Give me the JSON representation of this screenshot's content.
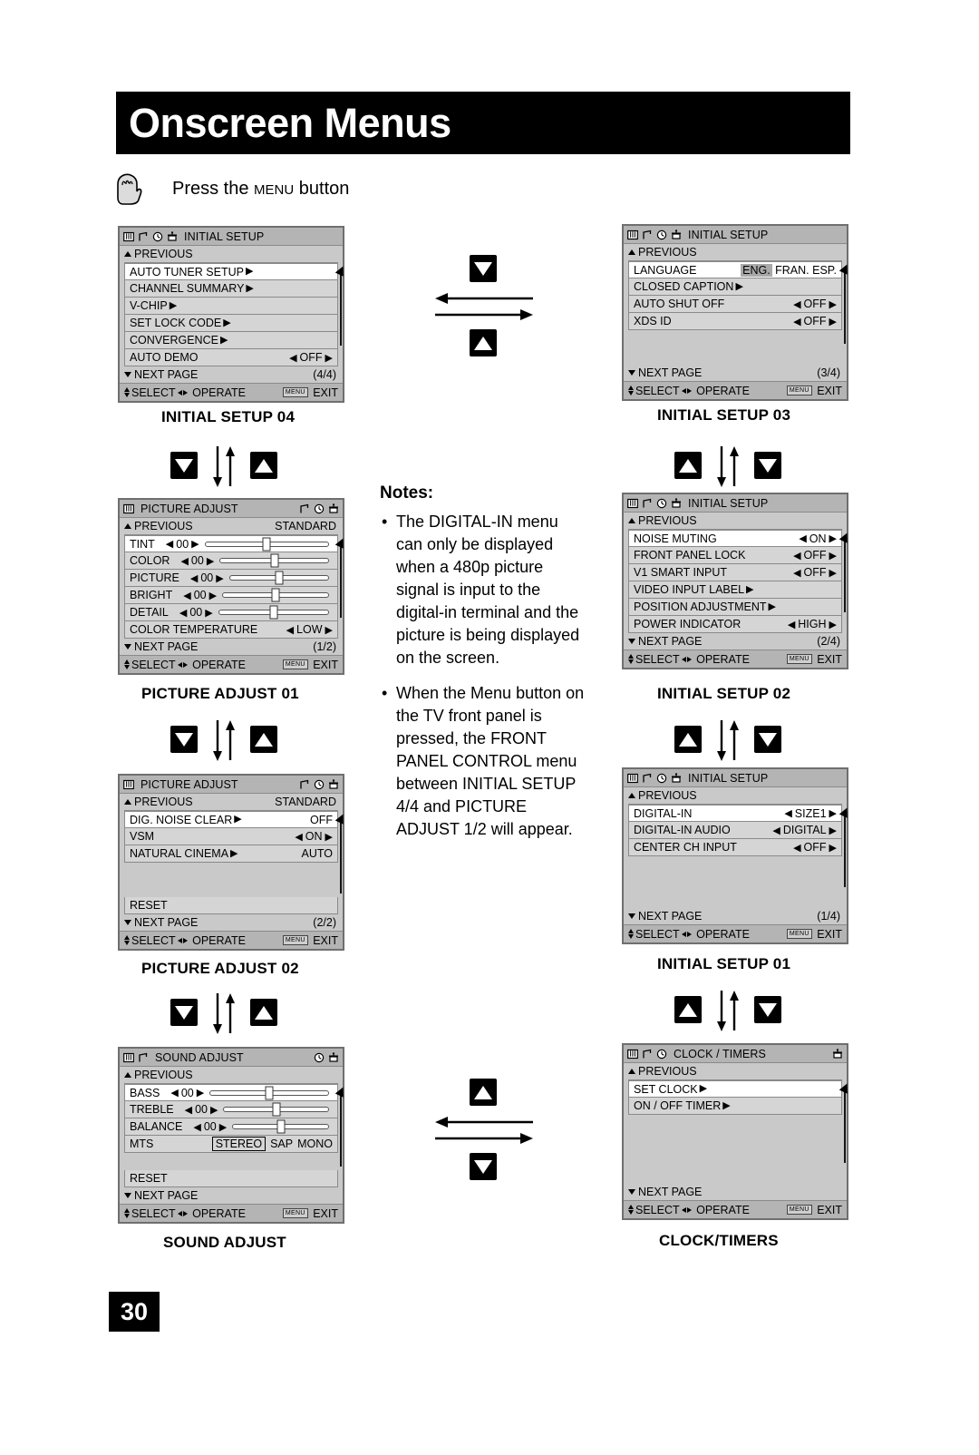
{
  "header": {
    "title": "Onscreen Menus"
  },
  "press": {
    "text_before": "Press the ",
    "menu_word": "MENU",
    "text_after": " button",
    "full": "Press the MENU button"
  },
  "page_number": "30",
  "notes": {
    "heading": "Notes:",
    "items": [
      "The DIGITAL-IN menu can only be displayed when a 480p picture signal is input to the digital-in terminal and the picture is being displayed on the screen.",
      "When the Menu button on the TV front panel is pressed, the FRONT PANEL CONTROL menu between INITIAL SETUP 4/4 and PICTURE ADJUST 1/2 will appear."
    ]
  },
  "footer_common": {
    "select": "SELECT",
    "operate": "OPERATE",
    "menu_key": "MENU",
    "exit": "EXIT"
  },
  "labels": {
    "previous": "PREVIOUS",
    "next_page": "NEXT PAGE",
    "standard": "STANDARD",
    "reset": "RESET"
  },
  "menus": [
    {
      "id": "initial-setup-04",
      "caption": "INITIAL SETUP 04",
      "title": "INITIAL SETUP",
      "title_icons": [
        "tv-icon",
        "music-note-icon",
        "clock-icon",
        "tuner-icon"
      ],
      "icons_side": "left",
      "page": "(4/4)",
      "rows": [
        {
          "name": "AUTO TUNER SETUP",
          "arrow": true,
          "value": "",
          "selected": true
        },
        {
          "name": "CHANNEL SUMMARY",
          "arrow": true,
          "value": "",
          "selected": false
        },
        {
          "name": "V-CHIP",
          "arrow": true,
          "value": "",
          "selected": false
        },
        {
          "name": "SET LOCK CODE",
          "arrow": true,
          "value": "",
          "selected": false
        },
        {
          "name": "CONVERGENCE",
          "arrow": true,
          "value": "",
          "selected": false
        },
        {
          "name": "AUTO DEMO",
          "arrow": false,
          "value": "OFF",
          "adjust": true,
          "selected": false
        }
      ]
    },
    {
      "id": "initial-setup-03",
      "caption": "INITIAL SETUP 03",
      "title": "INITIAL SETUP",
      "title_icons": [
        "tv-icon",
        "music-note-icon",
        "clock-icon",
        "tuner-icon"
      ],
      "page": "(3/4)",
      "rows": [
        {
          "name": "LANGUAGE",
          "arrow": false,
          "value": "ENG. FRAN. ESP.",
          "language": true,
          "selected": true
        },
        {
          "name": "CLOSED CAPTION",
          "arrow": true,
          "value": "",
          "selected": false
        },
        {
          "name": "AUTO SHUT OFF",
          "arrow": false,
          "value": "OFF",
          "adjust": true,
          "selected": false
        },
        {
          "name": "XDS ID",
          "arrow": false,
          "value": "OFF",
          "adjust": true,
          "selected": false
        },
        {
          "blank": true
        },
        {
          "blank": true
        }
      ]
    },
    {
      "id": "picture-adjust-01",
      "caption": "PICTURE ADJUST 01",
      "title": "PICTURE ADJUST",
      "title_icons": [
        "tv-icon"
      ],
      "title_icons_right": [
        "music-note-icon",
        "clock-icon",
        "tuner-icon"
      ],
      "corner": "STANDARD",
      "page": "(1/2)",
      "rows": [
        {
          "name": "TINT",
          "number": "00",
          "slider": true,
          "selected": true
        },
        {
          "name": "COLOR",
          "number": "00",
          "slider": true,
          "selected": false
        },
        {
          "name": "PICTURE",
          "number": "00",
          "slider": true,
          "selected": false
        },
        {
          "name": "BRIGHT",
          "number": "00",
          "slider": true,
          "selected": false
        },
        {
          "name": "DETAIL",
          "number": "00",
          "slider": true,
          "selected": false
        },
        {
          "name": "COLOR TEMPERATURE",
          "value": "LOW",
          "adjust": true,
          "selected": false
        }
      ]
    },
    {
      "id": "initial-setup-02",
      "caption": "INITIAL SETUP 02",
      "title": "INITIAL SETUP",
      "title_icons": [
        "tv-icon",
        "music-note-icon",
        "clock-icon",
        "tuner-icon"
      ],
      "page": "(2/4)",
      "rows": [
        {
          "name": "NOISE MUTING",
          "value": "ON",
          "adjust": true,
          "selected": true
        },
        {
          "name": "FRONT PANEL LOCK",
          "value": "OFF",
          "adjust": true,
          "selected": false
        },
        {
          "name": "V1 SMART INPUT",
          "value": "OFF",
          "adjust": true,
          "selected": false
        },
        {
          "name": "VIDEO INPUT LABEL",
          "arrow": true,
          "value": "",
          "selected": false
        },
        {
          "name": "POSITION ADJUSTMENT",
          "arrow": true,
          "value": "",
          "selected": false
        },
        {
          "name": "POWER INDICATOR",
          "value": "HIGH",
          "adjust": true,
          "selected": false
        }
      ]
    },
    {
      "id": "picture-adjust-02",
      "caption": "PICTURE ADJUST 02",
      "title": "PICTURE ADJUST",
      "title_icons": [
        "tv-icon"
      ],
      "title_icons_right": [
        "music-note-icon",
        "clock-icon",
        "tuner-icon"
      ],
      "corner": "STANDARD",
      "page": "(2/2)",
      "rows": [
        {
          "name": "DIG. NOISE CLEAR",
          "arrow": true,
          "value": "OFF",
          "plain_value": true,
          "selected": true
        },
        {
          "name": "VSM",
          "value": "ON",
          "adjust": true,
          "selected": false
        },
        {
          "name": "NATURAL CINEMA",
          "arrow": true,
          "value": "AUTO",
          "plain_value": true,
          "selected": false
        },
        {
          "blank": true
        },
        {
          "blank": true
        },
        {
          "name": "RESET",
          "value": "",
          "selected": false
        }
      ]
    },
    {
      "id": "initial-setup-01",
      "caption": "INITIAL SETUP 01",
      "title": "INITIAL SETUP",
      "title_icons": [
        "tv-icon",
        "music-note-icon",
        "clock-icon",
        "tuner-icon"
      ],
      "page": "(1/4)",
      "rows": [
        {
          "name": "DIGITAL-IN",
          "value": "SIZE1",
          "adjust": true,
          "selected": true
        },
        {
          "name": "DIGITAL-IN AUDIO",
          "value": "DIGITAL",
          "adjust": true,
          "selected": false
        },
        {
          "name": "CENTER CH INPUT",
          "value": "OFF",
          "adjust": true,
          "selected": false
        },
        {
          "blank": true
        },
        {
          "blank": true
        },
        {
          "blank": true
        }
      ]
    },
    {
      "id": "sound-adjust",
      "caption": "SOUND ADJUST",
      "title": "SOUND ADJUST",
      "title_icons": [
        "tv-icon",
        "music-note-icon"
      ],
      "title_icons_right": [
        "clock-icon",
        "tuner-icon"
      ],
      "page": "",
      "rows": [
        {
          "name": "BASS",
          "number": "00",
          "slider": true,
          "selected": true
        },
        {
          "name": "TREBLE",
          "number": "00",
          "slider": true,
          "selected": false
        },
        {
          "name": "BALANCE",
          "number": "00",
          "slider": true,
          "selected": false
        },
        {
          "name": "MTS",
          "mts": [
            "STEREO",
            "SAP",
            "MONO"
          ],
          "mts_selected": "STEREO",
          "selected": false
        },
        {
          "blank": true
        },
        {
          "name": "RESET",
          "value": "",
          "selected": false
        }
      ]
    },
    {
      "id": "clock-timers",
      "caption": "CLOCK/TIMERS",
      "title": "CLOCK / TIMERS",
      "title_icons": [
        "tv-icon",
        "music-note-icon",
        "clock-icon"
      ],
      "title_icons_right": [
        "tuner-icon"
      ],
      "page": "",
      "rows": [
        {
          "name": "SET CLOCK",
          "arrow": true,
          "value": "",
          "selected": true
        },
        {
          "name": "ON / OFF TIMER",
          "arrow": true,
          "value": "",
          "selected": false
        },
        {
          "blank": true
        },
        {
          "blank": true
        },
        {
          "blank": true
        },
        {
          "blank": true
        }
      ]
    }
  ],
  "nav_groups": [
    {
      "id": "nav-left-1",
      "buttons": [
        "down-button",
        "up-button"
      ],
      "arrows": "down-up"
    },
    {
      "id": "nav-left-2",
      "buttons": [
        "down-button",
        "up-button"
      ],
      "arrows": "down-up"
    },
    {
      "id": "nav-left-3",
      "buttons": [
        "down-button",
        "up-button"
      ],
      "arrows": "down-up"
    },
    {
      "id": "nav-right-1",
      "buttons": [
        "up-button",
        "down-button"
      ],
      "arrows": "down-up"
    },
    {
      "id": "nav-right-2",
      "buttons": [
        "up-button",
        "down-button"
      ],
      "arrows": "down-up"
    },
    {
      "id": "nav-right-3",
      "buttons": [
        "up-button",
        "down-button"
      ],
      "arrows": "down-up"
    },
    {
      "id": "nav-center-top",
      "buttons": [
        "down-button",
        "up-button"
      ],
      "arrows": "left-right"
    },
    {
      "id": "nav-center-bottom",
      "buttons": [
        "up-button",
        "down-button"
      ],
      "arrows": "left-right"
    }
  ]
}
